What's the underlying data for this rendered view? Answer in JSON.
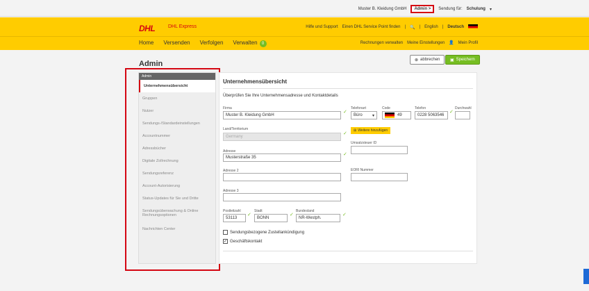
{
  "topbar": {
    "company": "Muster B. Kleidung GmbH",
    "admin": "Admin >",
    "shipment_label": "Sendung für:",
    "shipment_value": "Schulung"
  },
  "header": {
    "logo": "DHL",
    "logo_sub": "DHL Express",
    "help": "Hilfe und Support",
    "servicepoint": "Einen DHL Service Point finden",
    "lang_en": "English",
    "lang_de": "Deutsch"
  },
  "nav": {
    "home": "Home",
    "send": "Versenden",
    "track": "Verfolgen",
    "manage": "Verwalten",
    "manage_badge": "0",
    "invoices": "Rechnungen verwalten",
    "settings": "Meine Einstellungen",
    "profile": "Mein Profil"
  },
  "page": {
    "title": "Admin",
    "cancel": "abbrechen",
    "save": "Speichern"
  },
  "sidebar": {
    "head": "Admin",
    "items": [
      {
        "label": "Unternehmensübersicht"
      },
      {
        "label": "Gruppen"
      },
      {
        "label": "Nutzer"
      },
      {
        "label": "Sendungs-/Standardeinstellungen"
      },
      {
        "label": "Accountnummer"
      },
      {
        "label": "Adressbücher"
      },
      {
        "label": "Digitale Zollrechnung"
      },
      {
        "label": "Sendungsreferenz"
      },
      {
        "label": "Account-Autorisierung"
      },
      {
        "label": "Status-Updates für Sie und Dritte"
      },
      {
        "label": "Sendungsüberwachung & Online Rechnungsoptionen"
      },
      {
        "label": "Nachrichten Center"
      }
    ]
  },
  "form": {
    "title": "Unternehmensübersicht",
    "desc": "Überprüfen Sie Ihre Unternehmensadresse und Kontaktdetails",
    "company_label": "Firma",
    "company": "Muster B. Kleidung GmbH",
    "country_label": "Land/Territorium",
    "country": "Germany",
    "address_label": "Adresse",
    "address": "Musterstraße 35",
    "address2_label": "Adresse 2",
    "address2": "",
    "address3_label": "Adresse 3",
    "address3": "",
    "zip_label": "Postleitzahl",
    "zip": "53113",
    "city_label": "Stadt",
    "city": "BONN",
    "state_label": "Bundesland",
    "state": "NR-Westph.",
    "phonetype_label": "Telefonart",
    "phonetype": "Büro",
    "code_label": "Code",
    "code": "49",
    "phone_label": "Telefon",
    "phone": "0228 5063546",
    "ext_label": "Durchwahl",
    "ext": "",
    "add_more": "Weitere hinzufügen",
    "vat_label": "Umsatzsteuer ID",
    "vat": "",
    "eori_label": "EORI Nummer",
    "eori": "",
    "cb1": "Sendungsbezogene Zustellankündigung",
    "cb2": "Geschäftskontakt"
  }
}
